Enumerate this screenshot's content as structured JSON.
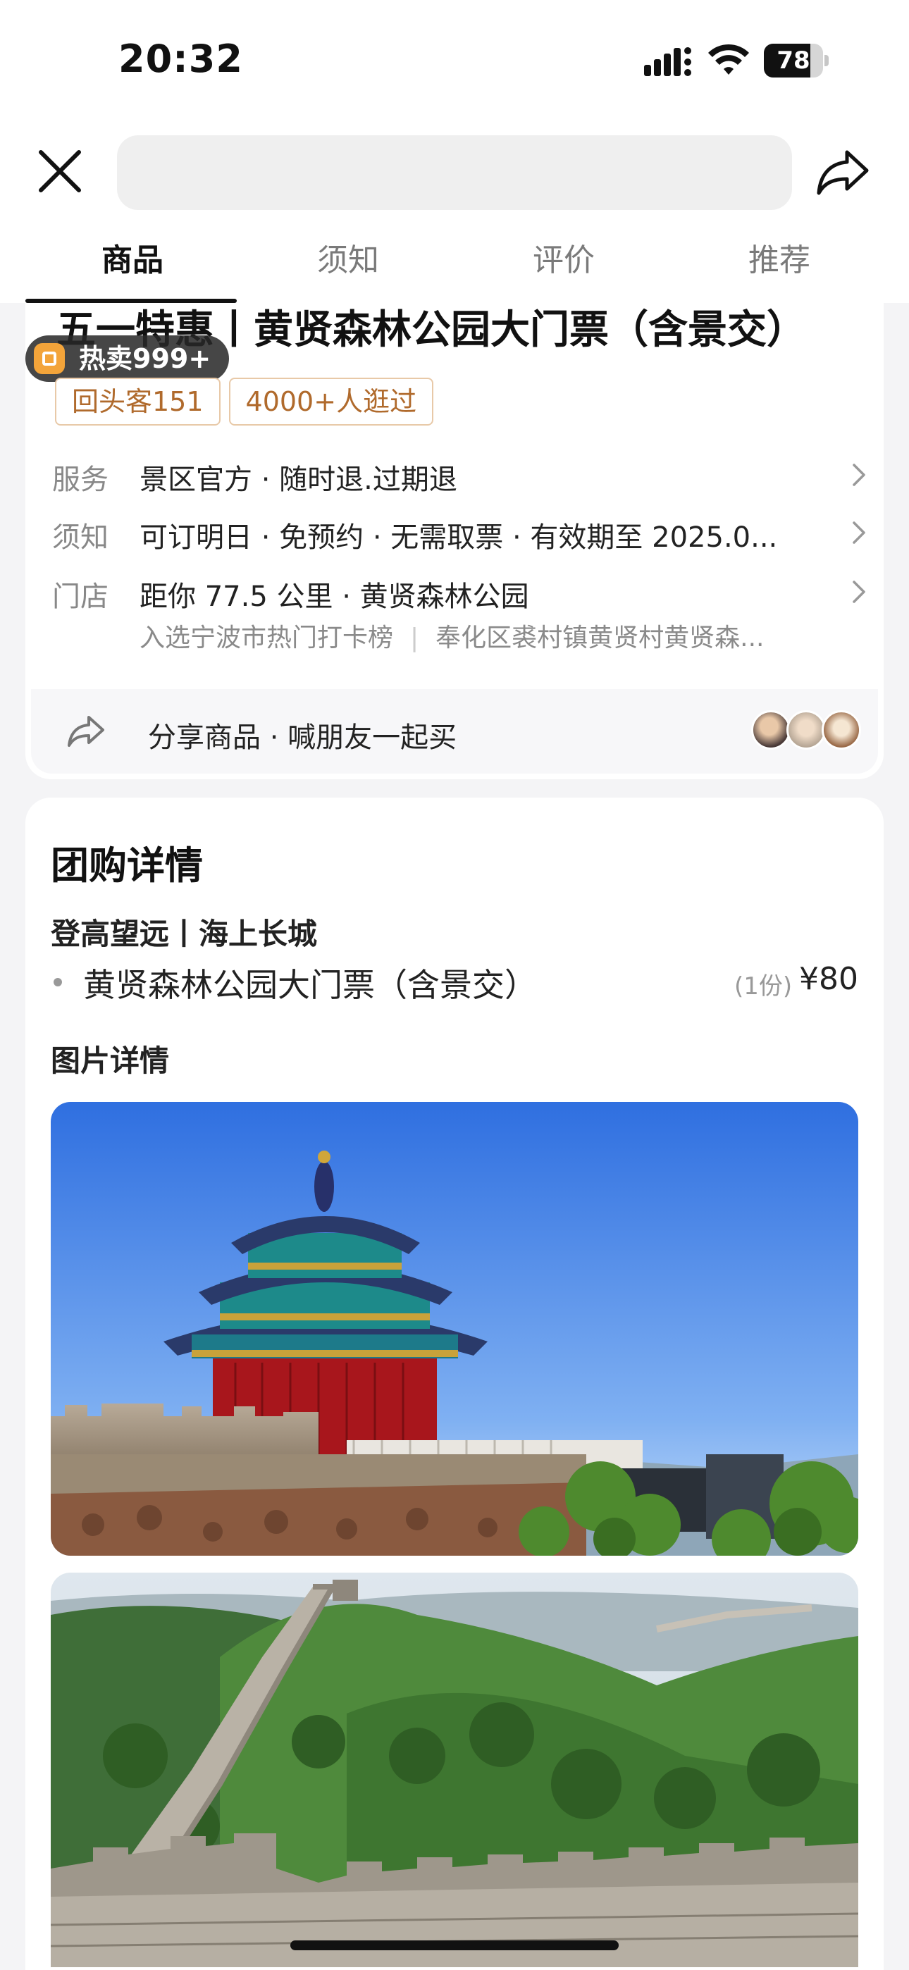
{
  "status_bar": {
    "time": "20:32",
    "battery": "78",
    "battery_level": 0.78
  },
  "navbar": {
    "search_value": "",
    "close_icon": "close-icon",
    "share_icon": "share-icon"
  },
  "tabs": [
    {
      "label": "商品",
      "active": true
    },
    {
      "label": "须知",
      "active": false
    },
    {
      "label": "评价",
      "active": false
    },
    {
      "label": "推荐",
      "active": false
    }
  ],
  "product": {
    "title": "五一特惠丨黄贤森林公园大门票（含景交）",
    "hot_badge": "热卖999+",
    "tags": [
      "回头客151",
      "4000+人逛过"
    ],
    "service_label": "服务",
    "service_value": "景区官方 · 随时退.过期退",
    "notice_label": "须知",
    "notice_value": "可订明日 · 免预约 · 无需取票 · 有效期至 2025.0...",
    "store_label": "门店",
    "store_value": "距你 77.5 公里 · 黄贤森林公园",
    "store_rank": "入选宁波市热门打卡榜",
    "store_address": "奉化区裘村镇黄贤村黄贤森...",
    "share_text": "分享商品 · 喊朋友一起买"
  },
  "details": {
    "heading": "团购详情",
    "subheading": "登高望远丨海上长城",
    "item_name": "黄贤森林公园大门票（含景交）",
    "item_qty": "(1份)",
    "item_price": "¥80",
    "pictures_heading": "图片详情"
  },
  "colors": {
    "accent_tag_text": "#b06a2c",
    "accent_tag_border": "#e8c9a8",
    "hot_badge_bg": "#2a2a2a",
    "hot_icon": "#f3a43a"
  }
}
